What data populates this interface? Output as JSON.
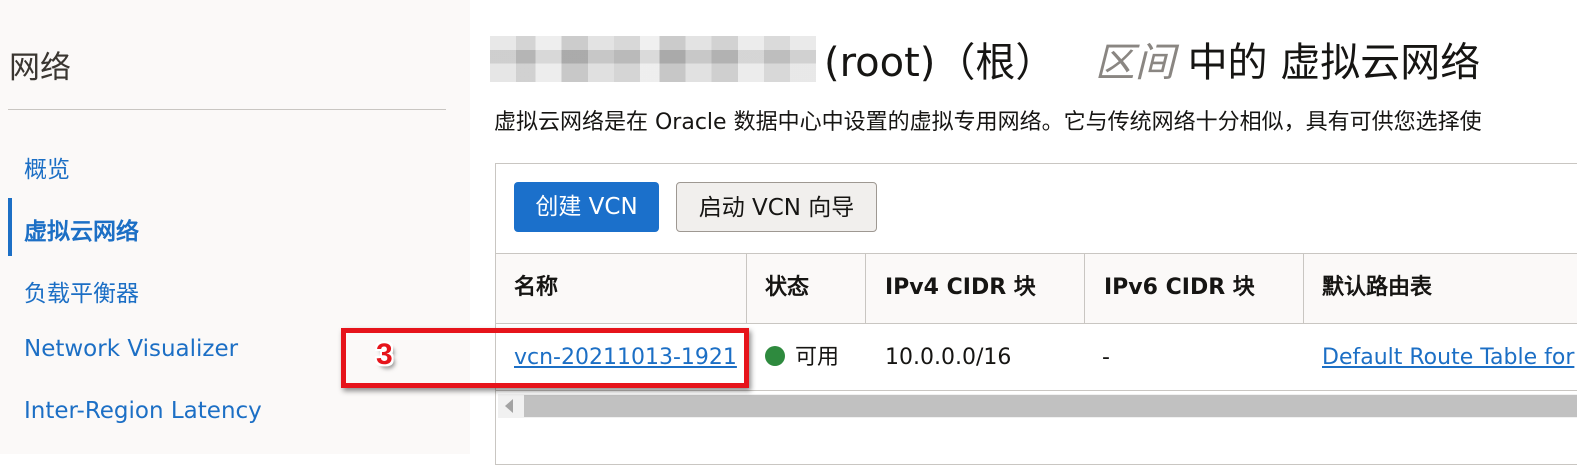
{
  "sidebar": {
    "title": "网络",
    "items": [
      {
        "label": "概览"
      },
      {
        "label": "虚拟云网络"
      },
      {
        "label": "负载平衡器"
      },
      {
        "label": "Network Visualizer"
      },
      {
        "label": "Inter-Region Latency"
      }
    ],
    "active_index": 1
  },
  "header": {
    "title_suffix_root": "(root)（根）",
    "title_compartment_word": "区间",
    "title_tail": "中的 虚拟云网络",
    "subtitle": "虚拟云网络是在 Oracle 数据中心中设置的虚拟专用网络。它与传统网络十分相似，具有可供您选择使"
  },
  "toolbar": {
    "create_label": "创建 VCN",
    "wizard_label": "启动 VCN 向导"
  },
  "table": {
    "columns": [
      "名称",
      "状态",
      "IPv4 CIDR 块",
      "IPv6 CIDR 块",
      "默认路由表"
    ],
    "rows": [
      {
        "name": "vcn-20211013-1921",
        "status": "可用",
        "ipv4": "10.0.0.0/16",
        "ipv6": "-",
        "route_table": "Default Route Table for"
      }
    ]
  },
  "annotation": {
    "step": "3"
  },
  "colors": {
    "link": "#1c6fc5",
    "primary_button": "#1b70cb",
    "status_available": "#2e8a3e",
    "annotation": "#e6141b"
  },
  "icons": {
    "status": "status-dot-icon",
    "scroll_left": "scroll-left-arrow-icon"
  }
}
